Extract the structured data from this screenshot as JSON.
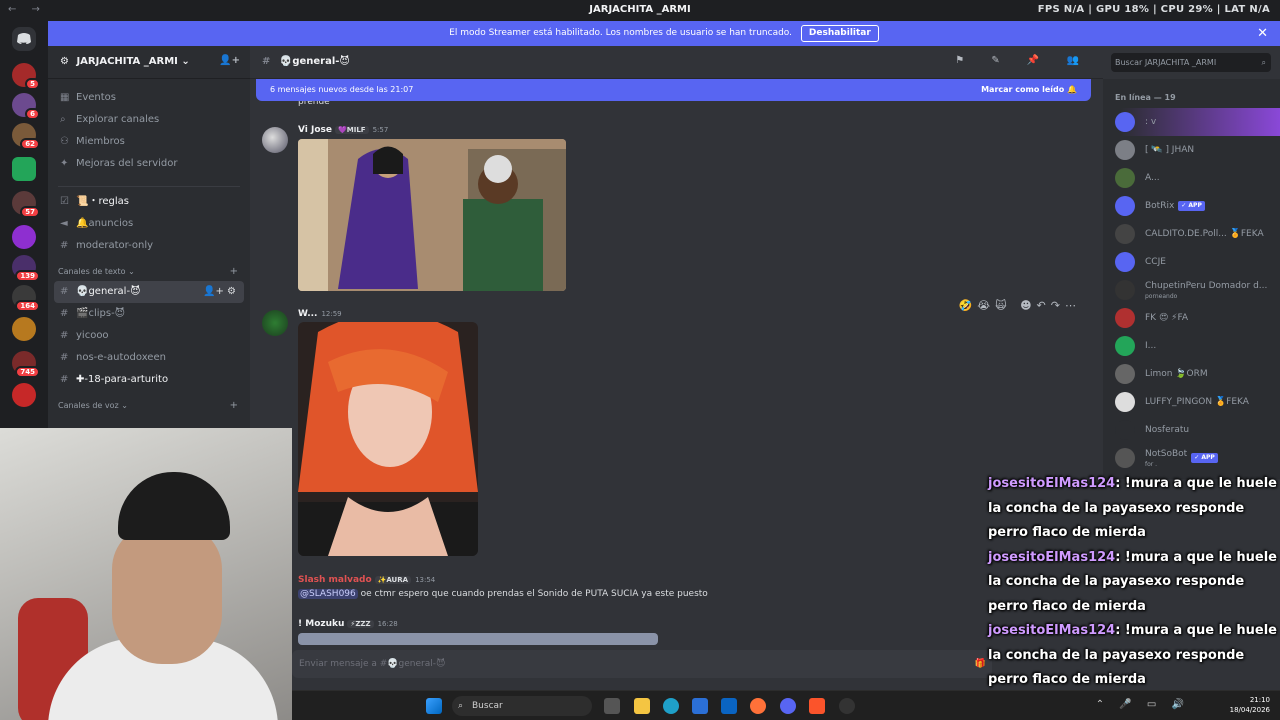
{
  "titlebar": {
    "nav": "← →",
    "title": "JARJACHITA _ARMI",
    "stats": "FPS N/A | GPU 18% | CPU 29% | LAT N/A"
  },
  "banner": {
    "text": "El modo Streamer está habilitado. Los nombres de usuario se han truncado.",
    "button": "Deshabilitar",
    "close": "✕"
  },
  "servers": {
    "badges": [
      "5",
      "6",
      "62",
      "57",
      "139",
      "164",
      "745"
    ]
  },
  "sidebar": {
    "guild_name": "JARJACHITA _ARMI ⌄",
    "top_items": [
      {
        "icon": "▦",
        "label": "Eventos"
      },
      {
        "icon": "⌕",
        "label": "Explorar canales"
      },
      {
        "icon": "⚇",
        "label": "Miembros"
      },
      {
        "icon": "✦",
        "label": "Mejoras del servidor"
      }
    ],
    "channels_top": [
      {
        "icon": "☑",
        "label": "📜・reglas",
        "bold": true
      },
      {
        "icon": "◄",
        "label": "🔔anuncios"
      },
      {
        "icon": "#",
        "label": "moderator-only"
      }
    ],
    "cat_text": "Canales de texto ⌄",
    "cat_text_plus": "+",
    "text_channels": [
      {
        "icon": "#",
        "label": "💀general-😈",
        "selected": true
      },
      {
        "icon": "#",
        "label": "🎬clips-😈"
      },
      {
        "icon": "#",
        "label": "yicooo"
      },
      {
        "icon": "#",
        "label": "nos-e-autodoxeen"
      },
      {
        "icon": "#",
        "label": "✚-18-para-arturito",
        "bold": true
      }
    ],
    "cat_voice": "Canales de voz ⌄",
    "cat_voice_plus": "+",
    "selected_actions": "👤+ ⚙"
  },
  "chat": {
    "channel_name": "💀general-😈",
    "header_icons": "⚑ ✎ 📌 👥",
    "search_placeholder": "Buscar JARJACHITA _ARMI",
    "search_icon": "⌕",
    "newbar_text": "6 mensajes nuevos desde las 21:07",
    "newbar_action": "Marcar como leído 🔔",
    "cut_text": "prende",
    "messages": [
      {
        "author": "Vi Jose",
        "tag": "💜MILF",
        "time": "5:57"
      },
      {
        "author": "W...",
        "tag": "",
        "time": "12:59"
      },
      {
        "author": "Slash malvado",
        "tag": "✨AURA",
        "time": "13:54",
        "mention": "@SLASH096",
        "text": " oe ctmr espero que cuando prendas el Sonido de PUTA SUCIA ya este puesto"
      },
      {
        "author": "! Mozuku",
        "tag": "⚡ZZZ",
        "time": "16:28"
      }
    ],
    "hover_tools": "🤣😭🙀 ☻↶↷⋯",
    "composer_placeholder": "Enviar mensaje a #💀general-😈",
    "composer_gift": "🎁"
  },
  "members": {
    "header": "En línea — 19",
    "list": [
      {
        "name": ": v",
        "color": "#5865f2",
        "highlight": true
      },
      {
        "name": "[ 🛰️ ] JHAN",
        "color": "#7c7f86"
      },
      {
        "name": "A...",
        "color": "#4a6b3a"
      },
      {
        "name": "BotRix",
        "color": "#5865f2",
        "app": "✓ APP"
      },
      {
        "name": "CALDITO.DE.Poll... 🏅FEKA",
        "color": "#444"
      },
      {
        "name": "CCJE",
        "color": "#5865f2"
      },
      {
        "name": "ChupetinPeru Domador d...",
        "color": "#333",
        "sub": "porneando"
      },
      {
        "name": "FK 😍 ⚡FA",
        "color": "#b03030"
      },
      {
        "name": "I...",
        "color": "#23a559"
      },
      {
        "name": "Limon 🍃ORM",
        "color": "#666"
      },
      {
        "name": "LUFFY_PINGON 🏅FEKA",
        "color": "#ddd"
      },
      {
        "name": "Nosferatu",
        "color": "#2b2d31"
      },
      {
        "name": "NotSoBot",
        "color": "#555",
        "app": "✓ APP",
        "sub": "for ."
      }
    ]
  },
  "overlay": {
    "lines": [
      {
        "user": "josesitoElMas124",
        "msg": ": !mura a que le huele la concha de la payasexo responde perro flaco de mierda"
      },
      {
        "user": "josesitoElMas124",
        "msg": ": !mura a que le huele la concha de la payasexo responde perro flaco de mierda"
      },
      {
        "user": "josesitoElMas124",
        "msg": ": !mura a que le huele la concha de la payasexo responde perro flaco de mierda"
      }
    ]
  },
  "taskbar": {
    "search": "Buscar",
    "search_icon": "⌕",
    "time": "21:10",
    "date": "18/04/2026",
    "tray": "⌃ 🎤 ▭ 🔊"
  }
}
